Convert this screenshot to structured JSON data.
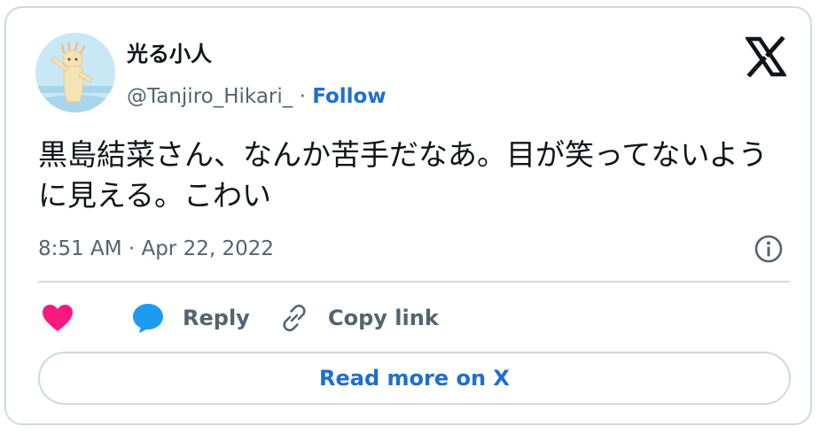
{
  "tweet": {
    "author": {
      "display_name": "光る小人",
      "handle": "@Tanjiro_Hikari_",
      "separator": " · ",
      "follow_label": "Follow",
      "avatar_icon": "avatar-image"
    },
    "text": "黒島結菜さん、なんか苦手だなあ。目が笑ってないように見える。こわい",
    "timestamp": "8:51 AM · Apr 22, 2022",
    "actions": {
      "like_icon": "heart-icon",
      "reply_label": "Reply",
      "reply_icon": "speech-bubble-icon",
      "copy_label": "Copy link",
      "copy_icon": "link-icon"
    },
    "read_more_label": "Read more on X",
    "brand_icon": "x-logo-icon",
    "info_icon": "info-icon"
  },
  "colors": {
    "link_blue": "#1d6fd1",
    "like_pink": "#f91880",
    "reply_blue": "#1d9bf0",
    "muted_gray": "#536471",
    "border": "#cfd9de"
  }
}
